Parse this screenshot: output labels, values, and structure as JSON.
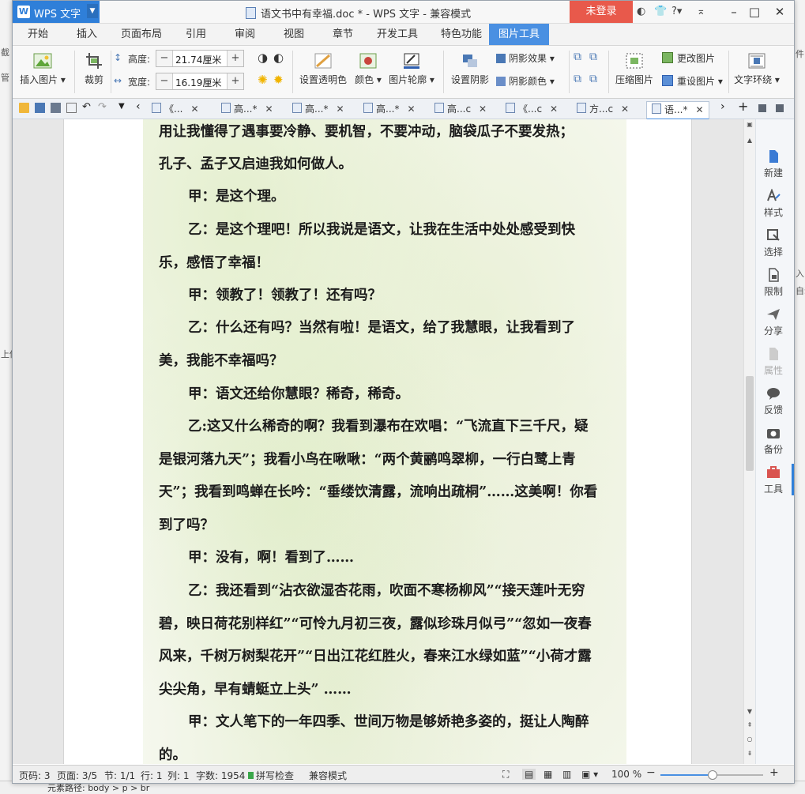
{
  "titlebar": {
    "app_name": "WPS 文字",
    "doc_title": "语文书中有幸福.doc * - WPS 文字 - 兼容模式",
    "login": "未登录",
    "help": "?"
  },
  "menu_tabs": [
    "开始",
    "插入",
    "页面布局",
    "引用",
    "审阅",
    "视图",
    "章节",
    "开发工具",
    "特色功能",
    "图片工具"
  ],
  "active_menu_tab": "图片工具",
  "ribbon": {
    "insert_picture": "插入图片",
    "crop": "裁剪",
    "height_label": "高度:",
    "height_value": "21.74厘米",
    "width_label": "宽度:",
    "width_value": "16.19厘米",
    "set_transparent": "设置透明色",
    "color": "颜色",
    "picture_outline": "图片轮廓",
    "set_shadow": "设置阴影",
    "shadow_effect": "阴影效果",
    "shadow_color": "阴影颜色",
    "compress_picture": "压缩图片",
    "change_picture": "更改图片",
    "reset_picture": "重设图片",
    "text_wrap": "文字环绕"
  },
  "doc_tabs": [
    "《...",
    "高...*",
    "高...*",
    "高...*",
    "高...c",
    "《...c",
    "方...c",
    "语...*"
  ],
  "document": {
    "lines": [
      {
        "text": "用让我懂得了遇事要冷静、要机智，不要冲动，脑袋瓜子不要发热；",
        "indent": false
      },
      {
        "text": "孔子、孟子又启迪我如何做人。",
        "indent": false
      },
      {
        "text": "甲：是这个理。",
        "indent": true
      },
      {
        "text": "乙：是这个理吧！所以我说是语文，让我在生活中处处感受到快乐，感悟了幸福！",
        "indent": true
      },
      {
        "text": "甲：领教了！领教了！还有吗？",
        "indent": true
      },
      {
        "text": "乙：什么还有吗？当然有啦！是语文，给了我慧眼，让我看到了美，我能不幸福吗？",
        "indent": true
      },
      {
        "text": "甲：语文还给你慧眼？稀奇，稀奇。",
        "indent": true
      },
      {
        "text": "乙:这又什么稀奇的啊？我看到瀑布在欢唱：“飞流直下三千尺，疑是银河落九天”；我看小鸟在啾啾：“两个黄鹂鸣翠柳，一行白鹭上青天”；我看到鸣蝉在长吟：“垂缕饮清露，流响出疏桐”……这美啊！你看到了吗？",
        "indent": true
      },
      {
        "text": "甲：没有，啊！看到了……",
        "indent": true
      },
      {
        "text": "乙：我还看到“沾衣欲湿杏花雨，吹面不寒杨柳风”“接天莲叶无穷碧，映日荷花别样红”“可怜九月初三夜，露似珍珠月似弓”“忽如一夜春风来，千树万树梨花开”“日出江花红胜火，春来江水绿如蓝”“小荷才露尖尖角，早有蜻蜓立上头” ……",
        "indent": true
      },
      {
        "text": "甲：文人笔下的一年四季、世间万物是够娇艳多姿的，挺让人陶醉的。",
        "indent": true
      }
    ]
  },
  "side_panel": [
    "新建",
    "样式",
    "选择",
    "限制",
    "分享",
    "属性",
    "反馈",
    "备份",
    "工具"
  ],
  "status": {
    "page_code": "页码: 3",
    "pages": "页面: 3/5",
    "section": "节: 1/1",
    "row": "行: 1",
    "col": "列: 1",
    "words": "字数: 1954",
    "spell": "拼写检查",
    "compat": "兼容模式",
    "zoom": "100 %",
    "zoom_fraction": 0.5
  },
  "background_fragments": {
    "left": [
      "截",
      "管",
      "上传"
    ],
    "right": [
      "件",
      "入",
      "自动"
    ],
    "bottom": "元素路径: body > p > br"
  },
  "colors": {
    "accent": "#2f7fd9",
    "login": "#e8594b"
  }
}
